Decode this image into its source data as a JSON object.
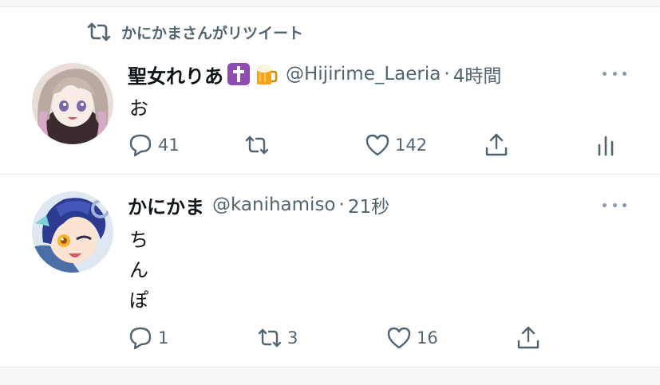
{
  "retweet_banner": {
    "text": "かにかまさんがリツイート",
    "icon": "retweet-icon"
  },
  "tweets": [
    {
      "display_name": "聖女れりあ",
      "badges": [
        "latin-cross-emoji",
        "beer-mug-emoji"
      ],
      "handle": "@Hijirime_Laeria",
      "separator": "·",
      "time": "4時間",
      "lines": [
        "お"
      ],
      "reply_count": "41",
      "retweet_count": "",
      "like_count": "142"
    },
    {
      "display_name": "かにかま",
      "handle": "@kanihamiso",
      "separator": "·",
      "time": "21秒",
      "lines": [
        "ち",
        "ん",
        "ぽ"
      ],
      "reply_count": "1",
      "retweet_count": "3",
      "like_count": "16"
    }
  ],
  "colors": {
    "secondary_text": "#536471",
    "primary_text": "#0f1419",
    "separator": "#e6e9eb",
    "background_gap": "#f7f9f9"
  }
}
